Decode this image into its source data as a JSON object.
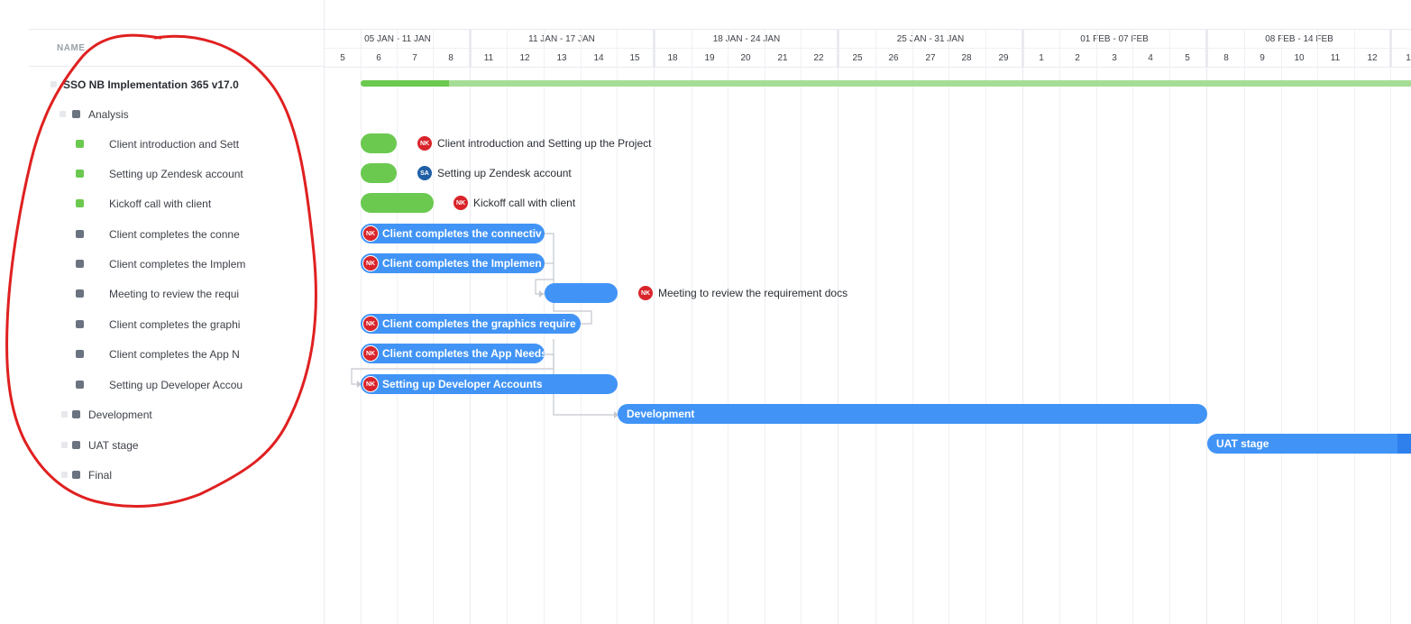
{
  "name_column": {
    "header": "NAME"
  },
  "weeks": [
    {
      "label": "05 JAN - 11 JAN"
    },
    {
      "label": "11 JAN - 17 JAN"
    },
    {
      "label": "18 JAN - 24 JAN"
    },
    {
      "label": "25 JAN - 31 JAN"
    },
    {
      "label": "01 FEB - 07 FEB"
    },
    {
      "label": "08 FEB - 14 FEB"
    }
  ],
  "days": [
    "5",
    "6",
    "7",
    "8",
    "11",
    "12",
    "13",
    "14",
    "15",
    "18",
    "19",
    "20",
    "21",
    "22",
    "25",
    "26",
    "27",
    "28",
    "29",
    "1",
    "2",
    "3",
    "4",
    "5",
    "8",
    "9",
    "10",
    "11",
    "12",
    "1"
  ],
  "rows": [
    {
      "name": "SSO NB Implementation 365 v17.0",
      "kind": "project"
    },
    {
      "name": "Analysis",
      "kind": "group"
    },
    {
      "name": "Client introduction and Sett",
      "kind": "task",
      "status_color": "#6bc950"
    },
    {
      "name": "Setting up Zendesk account",
      "kind": "task",
      "status_color": "#6bc950"
    },
    {
      "name": "Kickoff call with client",
      "kind": "task",
      "status_color": "#6bc950"
    },
    {
      "name": "Client completes the conne",
      "kind": "task",
      "status_color": "#6b7380"
    },
    {
      "name": "Client completes the Implem",
      "kind": "task",
      "status_color": "#6b7380"
    },
    {
      "name": "Meeting to review the requi",
      "kind": "task",
      "status_color": "#6b7380"
    },
    {
      "name": "Client completes the graphi",
      "kind": "task",
      "status_color": "#6b7380"
    },
    {
      "name": "Client completes the App N",
      "kind": "task",
      "status_color": "#6b7380"
    },
    {
      "name": "Setting up Developer Accou",
      "kind": "task",
      "status_color": "#6b7380"
    },
    {
      "name": "Development",
      "kind": "group"
    },
    {
      "name": "UAT stage",
      "kind": "group"
    },
    {
      "name": "Final",
      "kind": "group"
    }
  ],
  "bars": [
    {
      "text": "",
      "external_label": "Client introduction and Setting up the Project",
      "assignee": "NK"
    },
    {
      "text": "",
      "external_label": "Setting up Zendesk account",
      "assignee": "SA"
    },
    {
      "text": "",
      "external_label": "Kickoff call with client",
      "assignee": "NK"
    },
    {
      "text": "Client completes the connectiv",
      "assignee": "NK"
    },
    {
      "text": "Client completes the Implemen",
      "assignee": "NK"
    },
    {
      "text": "",
      "external_label": "Meeting to review the requirement docs",
      "assignee": "NK"
    },
    {
      "text": "Client completes the graphics require",
      "assignee": "NK"
    },
    {
      "text": "Client completes the App Needs",
      "assignee": "NK"
    },
    {
      "text": "Setting up Developer Accounts",
      "assignee": "NK"
    },
    {
      "text": "Development"
    },
    {
      "text": "UAT stage"
    }
  ],
  "colors": {
    "done": "#6bc950",
    "todo": "#6b7380",
    "bar_blue": "#4194f6",
    "progress_track": "#a6dd96",
    "avatar_nk": "#d9242b",
    "avatar_sa": "#1f5fa6",
    "annotation": "#e02020"
  }
}
